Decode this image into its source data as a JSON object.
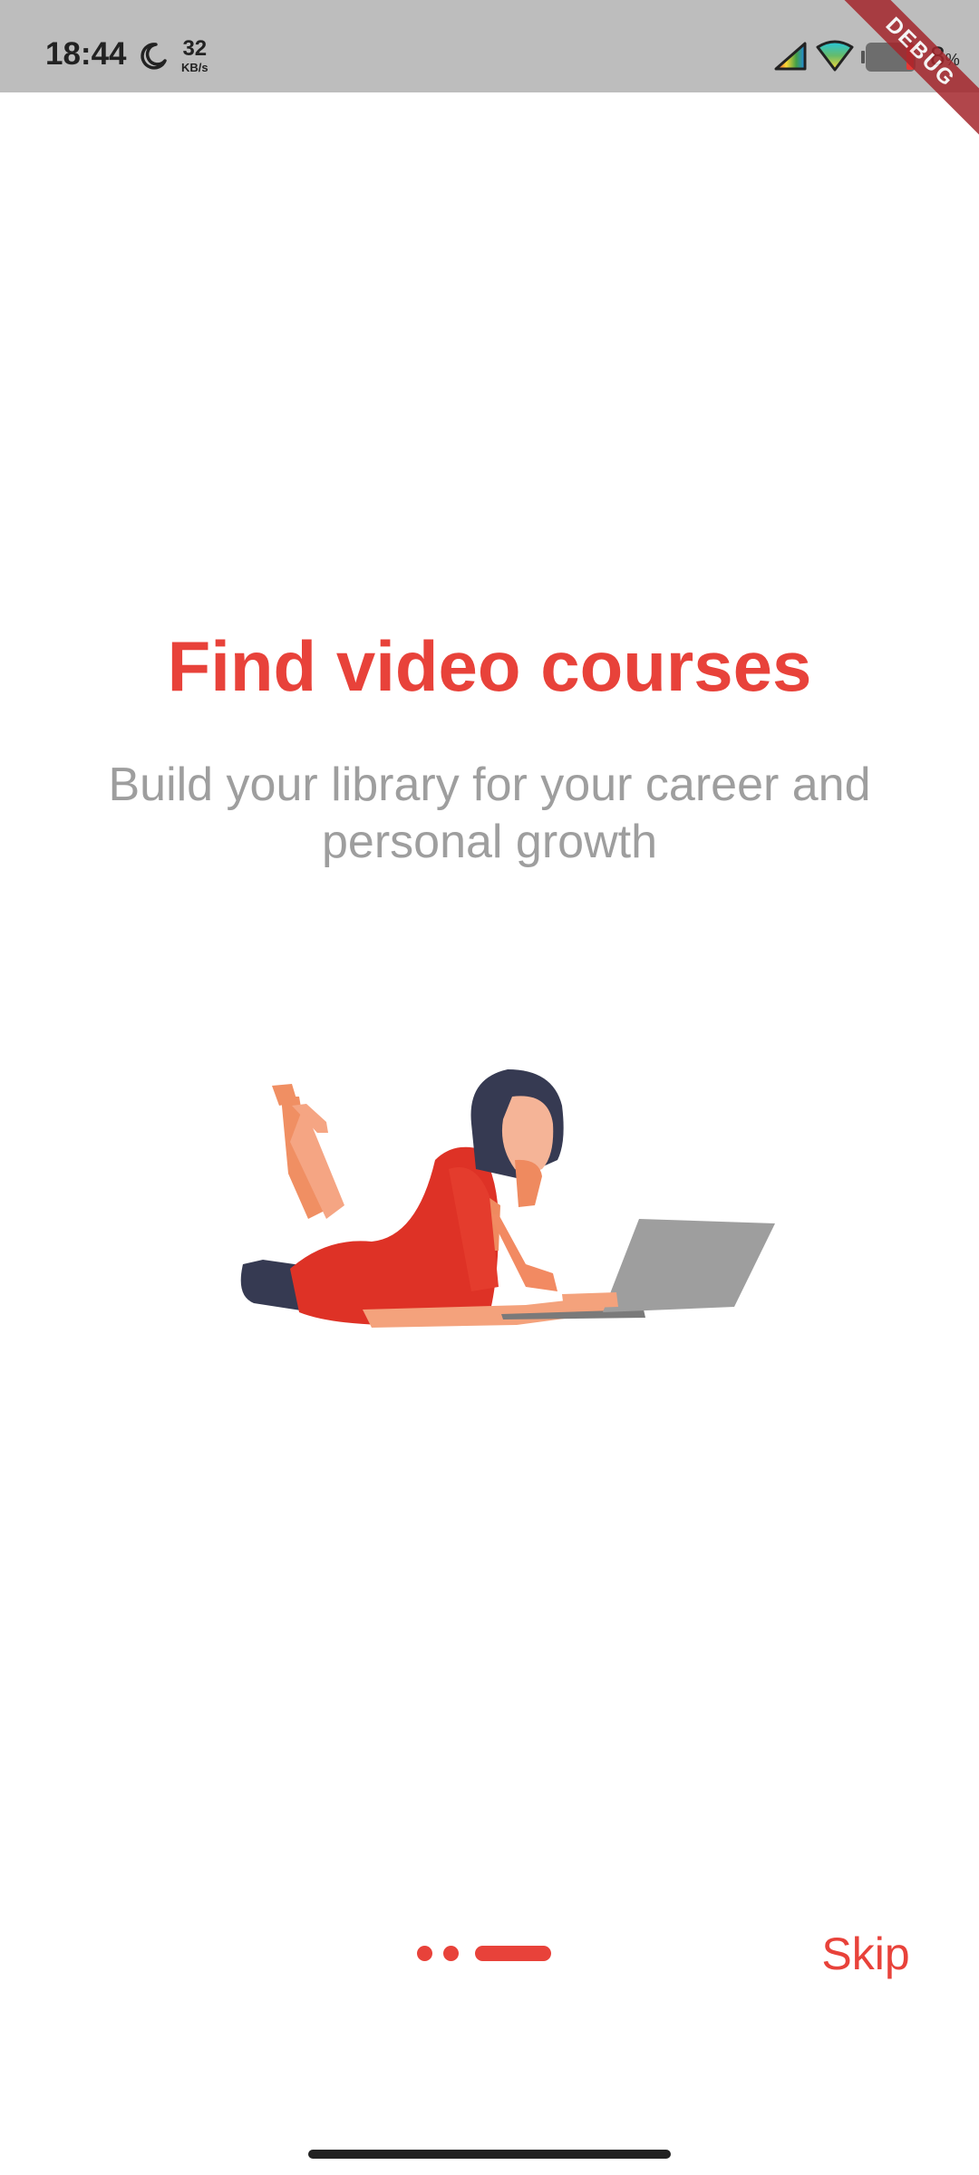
{
  "status_bar": {
    "time": "18:44",
    "network_speed_value": "32",
    "network_speed_unit": "KB/s",
    "battery_percent": "8",
    "battery_percent_sign": "%",
    "icons": [
      "moon-icon",
      "signal-icon",
      "wifi-icon",
      "battery-icon"
    ]
  },
  "debug_banner": "DEBUG",
  "onboarding": {
    "title": "Find video courses",
    "subtitle": "Build your library for your career and personal growth",
    "illustration": "woman-with-laptop-illustration",
    "page_count": 3,
    "active_page": 3
  },
  "controls": {
    "skip_label": "Skip"
  },
  "colors": {
    "accent": "#e8423a",
    "subtitle": "#9e9e9e",
    "status_bar": "#bdbdbd",
    "hair": "#363a52",
    "skin": "#f4a27c",
    "dress": "#de3226",
    "laptop": "#9e9e9e"
  }
}
